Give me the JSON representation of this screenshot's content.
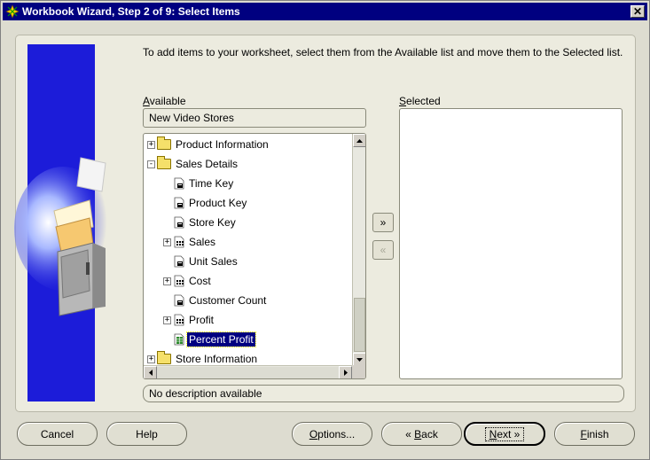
{
  "window": {
    "title": "Workbook Wizard, Step 2 of 9: Select Items",
    "close_glyph": "✕"
  },
  "instruction": "To add items to your worksheet, select them from the Available list and move them to the Selected list.",
  "available": {
    "label": "Available",
    "label_mnemonic": "A",
    "label_rest": "vailable",
    "business_area": "New Video Stores",
    "tree": [
      {
        "label": "Product Information",
        "type": "folder",
        "expander": "+",
        "level": 0
      },
      {
        "label": "Sales Details",
        "type": "folder",
        "expander": "-",
        "level": 0
      },
      {
        "label": "Time Key",
        "type": "item",
        "expander": "",
        "level": 1
      },
      {
        "label": "Product Key",
        "type": "item",
        "expander": "",
        "level": 1
      },
      {
        "label": "Store Key",
        "type": "item",
        "expander": "",
        "level": 1
      },
      {
        "label": "Sales",
        "type": "measure",
        "expander": "+",
        "level": 1
      },
      {
        "label": "Unit Sales",
        "type": "item",
        "expander": "",
        "level": 1
      },
      {
        "label": "Cost",
        "type": "measure",
        "expander": "+",
        "level": 1
      },
      {
        "label": "Customer Count",
        "type": "item",
        "expander": "",
        "level": 1
      },
      {
        "label": "Profit",
        "type": "measure",
        "expander": "+",
        "level": 1
      },
      {
        "label": "Percent Profit",
        "type": "calc",
        "expander": "",
        "level": 1,
        "selected": true
      },
      {
        "label": "Store Information",
        "type": "folder",
        "expander": "+",
        "level": 0
      }
    ]
  },
  "selected_panel": {
    "label_mnemonic": "S",
    "label_rest": "elected"
  },
  "move_buttons": {
    "add": "»",
    "remove": "«"
  },
  "description": "No description available",
  "buttons": {
    "cancel": "Cancel",
    "help": "Help",
    "options": "Options...",
    "options_mnemonic": "O",
    "options_rest": "ptions...",
    "back_arrow": "«",
    "back_mnemonic": "B",
    "back_rest": "ack",
    "next_mnemonic": "N",
    "next_rest": "ext",
    "next_arrow": "»",
    "finish_mnemonic": "F",
    "finish_rest": "inish"
  },
  "colors": {
    "titlebar": "#000080",
    "art": "#1c1cd9",
    "selection": "#000080"
  }
}
